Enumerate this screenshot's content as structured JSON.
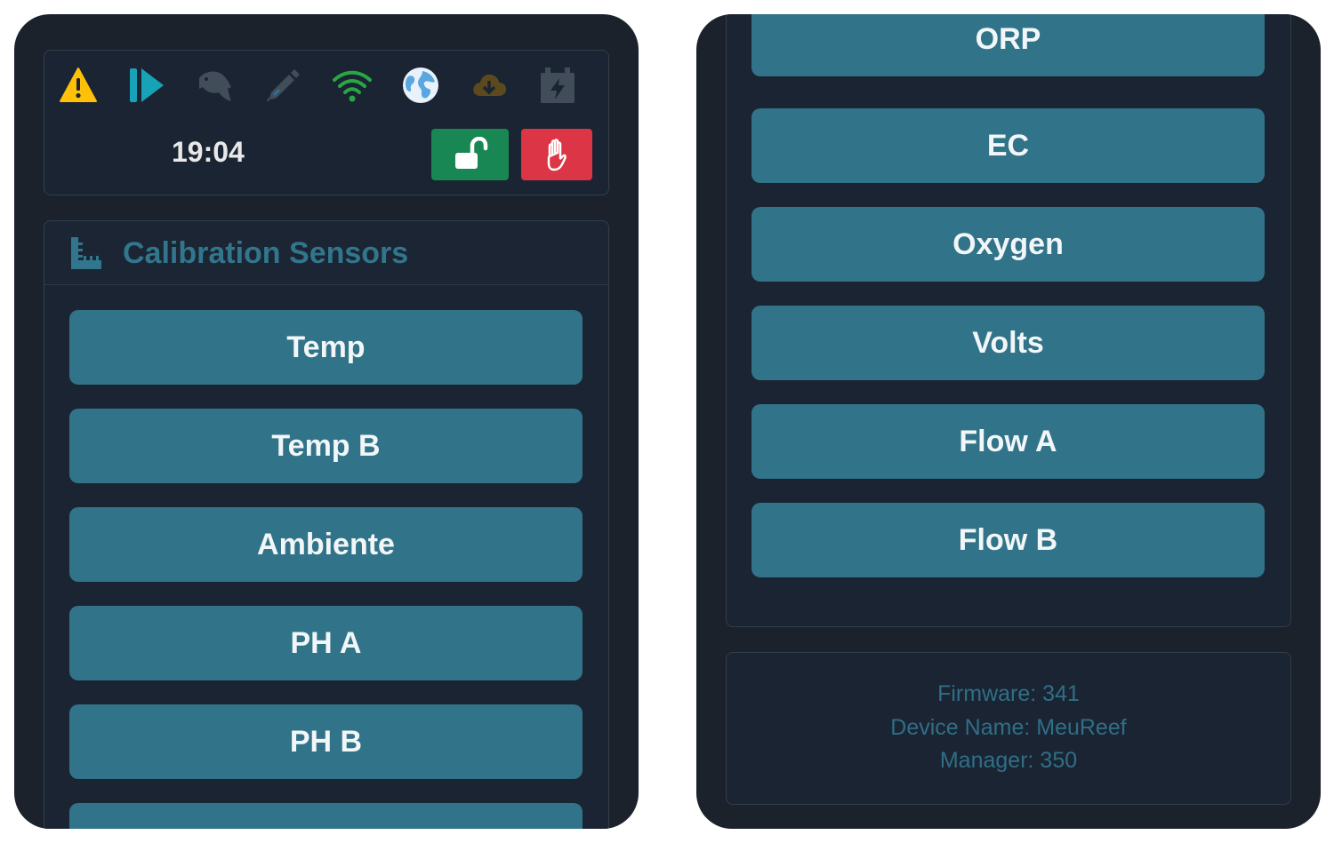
{
  "status_bar": {
    "icons": [
      {
        "name": "warning-icon",
        "color": "#ffc107"
      },
      {
        "name": "play-forward-icon",
        "color": "#17a2b8"
      },
      {
        "name": "fish-icon",
        "color": "#3e4a56"
      },
      {
        "name": "dropper-icon",
        "color": "#3e4a56"
      },
      {
        "name": "wifi-icon",
        "color": "#28a745"
      },
      {
        "name": "globe-icon",
        "color": "#6cb4e8"
      },
      {
        "name": "cloud-download-icon",
        "color": "#5a4a20"
      },
      {
        "name": "battery-charge-icon",
        "color": "#3e4a56"
      }
    ],
    "time": "19:04"
  },
  "actions": {
    "unlock": {
      "icon": "unlock-icon",
      "color": "#198754"
    },
    "stop": {
      "icon": "hand-stop-icon",
      "color": "#dc3545"
    }
  },
  "calibration": {
    "icon": "ruler-icon",
    "title": "Calibration Sensors",
    "sensors_left": [
      "Temp",
      "Temp B",
      "Ambiente",
      "PH A",
      "PH B"
    ],
    "sensors_right": [
      "ORP",
      "EC",
      "Oxygen",
      "Volts",
      "Flow A",
      "Flow B"
    ]
  },
  "info": {
    "firmware": "Firmware: 341",
    "device_name": "Device Name: MeuReef",
    "manager": "Manager: 350"
  },
  "colors": {
    "background": "#1b222c",
    "panel": "#1b2432",
    "button": "#31748a",
    "title": "#31768c",
    "info_text": "#2f6f86"
  }
}
